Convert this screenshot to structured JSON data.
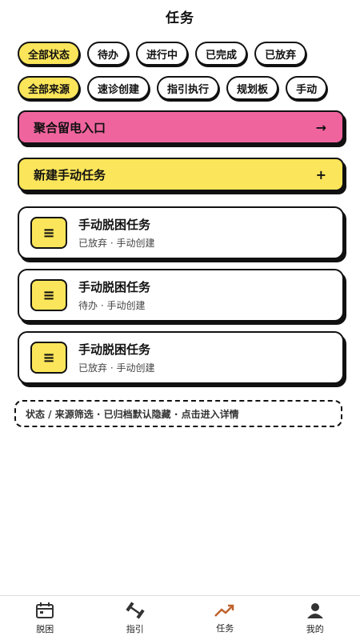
{
  "page_title": "任务",
  "status_filters": [
    {
      "label": "全部状态",
      "active": true
    },
    {
      "label": "待办",
      "active": false
    },
    {
      "label": "进行中",
      "active": false
    },
    {
      "label": "已完成",
      "active": false
    },
    {
      "label": "已放弃",
      "active": false
    }
  ],
  "source_filters": [
    {
      "label": "全部来源",
      "active": true
    },
    {
      "label": "速诊创建",
      "active": false
    },
    {
      "label": "指引执行",
      "active": false
    },
    {
      "label": "规划板",
      "active": false
    },
    {
      "label": "手动",
      "active": false
    }
  ],
  "banners": {
    "voicemail": {
      "label": "聚合留电入口",
      "trail": "→"
    },
    "new_task": {
      "label": "新建手动任务",
      "trail": "+"
    }
  },
  "tasks": [
    {
      "icon": "≡",
      "title": "手动脱困任务",
      "meta": "已放弃 · 手动创建"
    },
    {
      "icon": "≡",
      "title": "手动脱困任务",
      "meta": "待办 · 手动创建"
    },
    {
      "icon": "≡",
      "title": "手动脱困任务",
      "meta": "已放弃 · 手动创建"
    }
  ],
  "hint": "状态 / 来源筛选 · 已归档默认隐藏 · 点击进入详情",
  "tabbar": [
    {
      "label": "脱困",
      "icon": "calendar-icon",
      "active": false
    },
    {
      "label": "指引",
      "icon": "dumbbell-icon",
      "active": false
    },
    {
      "label": "任务",
      "icon": "trend-up-icon",
      "active": true
    },
    {
      "label": "我的",
      "icon": "person-icon",
      "active": false
    }
  ],
  "colors": {
    "accent_yellow": "#fbe55a",
    "accent_pink": "#f0649e",
    "trend_active": "#c0622f"
  }
}
